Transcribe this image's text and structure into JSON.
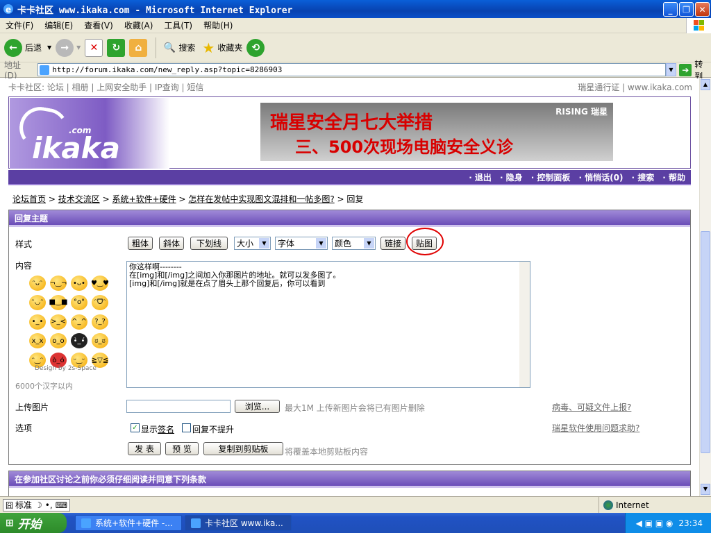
{
  "window": {
    "title": "卡卡社区 www.ikaka.com - Microsoft Internet Explorer"
  },
  "menu": [
    "文件(F)",
    "编辑(E)",
    "查看(V)",
    "收藏(A)",
    "工具(T)",
    "帮助(H)"
  ],
  "toolbar": {
    "back": "后退",
    "search": "搜索",
    "favorites": "收藏夹"
  },
  "address": {
    "label": "地址(D)",
    "url": "http://forum.ikaka.com/new_reply.asp?topic=8286903",
    "go": "转到"
  },
  "topnav": {
    "left": "卡卡社区: 论坛 | 相册 | 上网安全助手 | IP查询 | 短信",
    "right": "瑞星通行证 | www.ikaka.com"
  },
  "logo": {
    "text": "ikaka",
    "com": ".com"
  },
  "ad": {
    "line1": "瑞星安全月七大举措",
    "line2": "三、500次现场电脑安全义诊",
    "brand": "RISING 瑞星"
  },
  "navbar": [
    "· 退出",
    "· 隐身",
    "· 控制面板",
    "· 悄悄话(0)",
    "· 搜索",
    "· 帮助"
  ],
  "breadcrumb": {
    "home": "论坛首页",
    "s1": "技术交流区",
    "s2": "系统+软件+硬件",
    "s3": "怎样在发帖中实现图文混排和一帖多图?",
    "s4": "回复",
    "sep": ">"
  },
  "panel": {
    "title": "回复主题",
    "style_label": "样式",
    "bold": "粗体",
    "italic": "斜体",
    "underline": "下划线",
    "size": "大小",
    "font": "字体",
    "color": "颜色",
    "link": "链接",
    "image": "贴图",
    "content_label": "内容",
    "content": [
      "你这样啊--------",
      "在[img]和[/img]之间加入你那图片的地址。就可以发多图了。",
      "[img]和[/img]就是在点了眉头上那个回复后，你可以看到"
    ],
    "design": "Design by 2s-Space",
    "limit": "6000个汉字以内",
    "upload_label": "上传图片",
    "browse": "浏览...",
    "upload_hint": "最大1M 上传新图片会将已有图片删除",
    "virus_link": "病毒、可疑文件上报?",
    "options_label": "选项",
    "show_sig_1": "显示",
    "show_sig_2": "签名",
    "no_bump": "回复不提升",
    "help_link": "瑞星软件使用问题求助?",
    "submit": "发 表",
    "preview": "预 览",
    "copy": "复制到剪贴板",
    "copy_hint": "将覆盖本地剪贴板内容"
  },
  "panel2": {
    "title": "在参加社区讨论之前你必须仔细阅读并同意下列条款"
  },
  "status": {
    "ime": "标准",
    "zone": "Internet"
  },
  "taskbar": {
    "start": "开始",
    "task1": "系统+软件+硬件 -...",
    "task2": "卡卡社区 www.ika...",
    "clock": "23:34"
  }
}
